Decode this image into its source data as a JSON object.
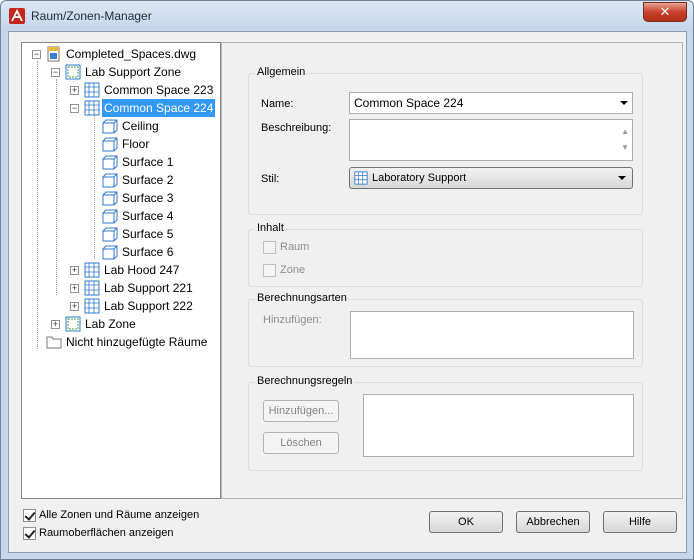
{
  "window": {
    "title": "Raum/Zonen-Manager",
    "close_label": "✕"
  },
  "tree": {
    "items": [
      {
        "label": "Completed_Spaces.dwg",
        "expander": "−"
      },
      {
        "label": "Lab Support Zone",
        "expander": "−"
      },
      {
        "label": "Common Space 223",
        "expander": "+"
      },
      {
        "label": "Common Space 224",
        "expander": "−"
      },
      {
        "label": "Ceiling"
      },
      {
        "label": "Floor"
      },
      {
        "label": "Surface 1"
      },
      {
        "label": "Surface 2"
      },
      {
        "label": "Surface 3"
      },
      {
        "label": "Surface 4"
      },
      {
        "label": "Surface 5"
      },
      {
        "label": "Surface 6"
      },
      {
        "label": "Lab Hood 247",
        "expander": "+"
      },
      {
        "label": "Lab Support 221",
        "expander": "+"
      },
      {
        "label": "Lab Support 222",
        "expander": "+"
      },
      {
        "label": "Lab Zone",
        "expander": "+"
      },
      {
        "label": "Nicht hinzugefügte Räume"
      }
    ]
  },
  "general": {
    "title": "Allgemein",
    "name_label": "Name:",
    "name_value": "Common Space 224",
    "description_label": "Beschreibung:",
    "description_value": "",
    "style_label": "Stil:",
    "style_value": "Laboratory Support"
  },
  "content": {
    "title": "Inhalt",
    "room_label": "Raum",
    "zone_label": "Zone"
  },
  "calc_types": {
    "title": "Berechnungsarten",
    "add_label": "Hinzufügen:"
  },
  "calc_rules": {
    "title": "Berechnungsregeln",
    "add_button": "Hinzufügen...",
    "delete_button": "Löschen"
  },
  "options": {
    "show_all_label": "Alle Zonen und Räume anzeigen",
    "show_all_checked": true,
    "show_surfaces_label": "Raumoberflächen anzeigen",
    "show_surfaces_checked": true
  },
  "buttons": {
    "ok": "OK",
    "cancel": "Abbrechen",
    "help": "Hilfe"
  },
  "colors": {
    "selection": "#3399ff",
    "frame": "#c6d7ea",
    "close": "#c8412b"
  }
}
